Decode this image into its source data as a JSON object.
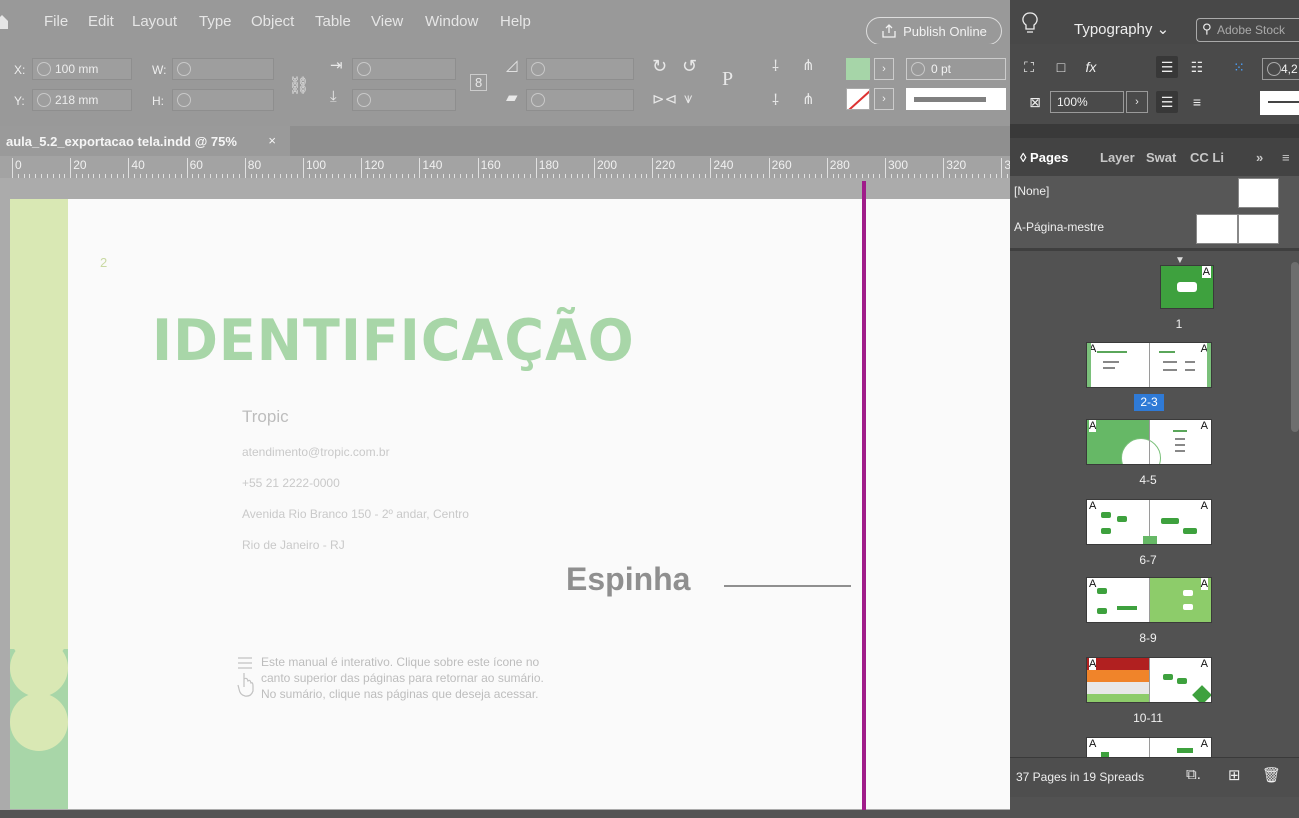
{
  "menu": {
    "items": [
      "File",
      "Edit",
      "Layout",
      "Type",
      "Object",
      "Table",
      "View",
      "Window",
      "Help"
    ],
    "publish_label": "Publish Online"
  },
  "control": {
    "x_label": "X:",
    "x_value": "100 mm",
    "y_label": "Y:",
    "y_value": "218 mm",
    "w_label": "W:",
    "h_label": "H:",
    "stroke_weight": "0 pt",
    "proxy_glyph": "P"
  },
  "document": {
    "tab_title": "aula_5.2_exportacao tela.indd @ 75%",
    "close_glyph": "×"
  },
  "ruler": {
    "labels": [
      "0",
      "20",
      "40",
      "60",
      "80",
      "100",
      "120",
      "140",
      "160",
      "180",
      "200",
      "220",
      "240",
      "260",
      "280",
      "300",
      "320",
      "3"
    ]
  },
  "page": {
    "page_number": "2",
    "heading": "IDENTIFICAÇÃO",
    "company": "Tropic",
    "email": "atendimento@tropic.com.br",
    "phone": "+55 21 2222-0000",
    "address": "Avenida Rio Branco 150 - 2º andar, Centro",
    "city": "Rio de Janeiro - RJ",
    "note_line1": "Este manual é interativo. Clique sobre este ícone no",
    "note_line2": "canto superior das páginas para retornar ao sumário.",
    "note_line3": "No sumário, clique nas páginas que deseja acessar.",
    "annotation": "Espinha"
  },
  "panel": {
    "workspace": "Typography",
    "search_placeholder": "Adobe Stock",
    "zoom_percent": "100%",
    "leading_value": "4,2",
    "tabs": [
      "Pages",
      "Layer",
      "Swat",
      "CC Li"
    ],
    "tab_more": "»",
    "masters": [
      "[None]",
      "A-Página-mestre"
    ],
    "master_letter": "A",
    "spreads": [
      "1",
      "2-3",
      "4-5",
      "6-7",
      "8-9",
      "10-11"
    ],
    "footer_count": "37 Pages in 19 Spreads"
  },
  "colors": {
    "accent_green": "#a8d6a8",
    "light_green": "#d9e8b4",
    "spine_magenta": "#a01c8a",
    "selection_blue": "#2f7ad6"
  }
}
